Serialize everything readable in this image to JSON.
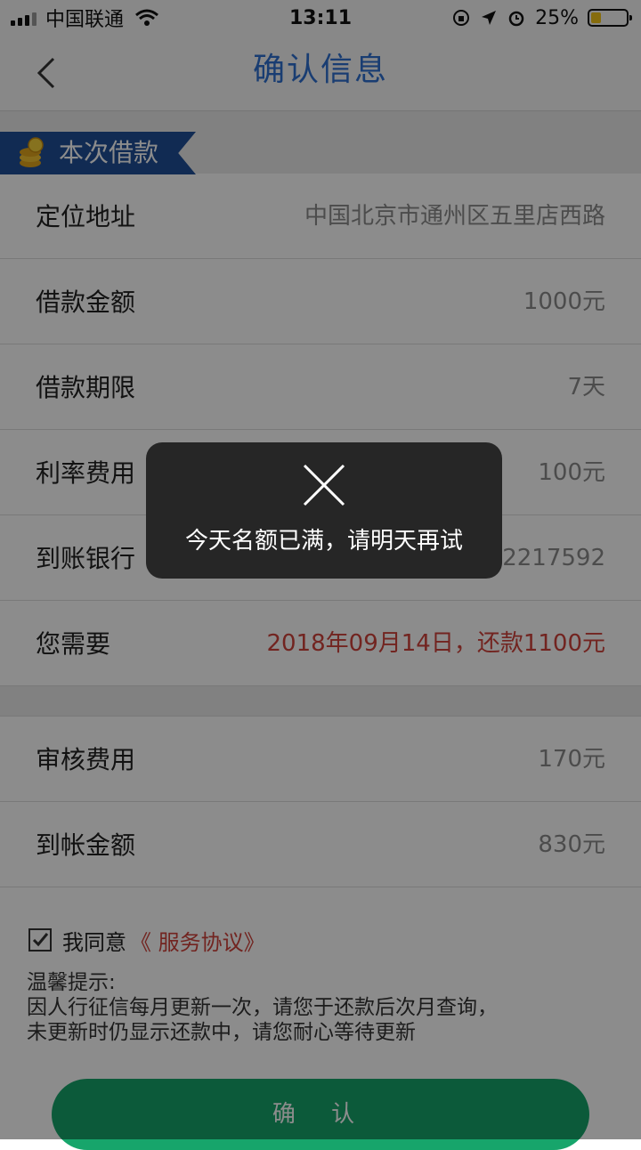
{
  "status_bar": {
    "carrier": "中国联通",
    "time": "13:11",
    "battery_percent": "25%",
    "battery_level": 0.25
  },
  "nav": {
    "title": "确认信息"
  },
  "section": {
    "title": "本次借款"
  },
  "rows": [
    {
      "label": "定位地址",
      "value": "中国北京市通州区五里店西路"
    },
    {
      "label": "借款金额",
      "value": "1000元"
    },
    {
      "label": "借款期限",
      "value": "7天"
    },
    {
      "label": "利率费用",
      "value": "100元"
    },
    {
      "label": "到账银行",
      "value": "52217592"
    },
    {
      "label": "您需要",
      "value": "2018年09月14日，还款1100元"
    }
  ],
  "fees": [
    {
      "label": "审核费用",
      "value": "170元"
    },
    {
      "label": "到帐金额",
      "value": "830元"
    }
  ],
  "agreement": {
    "text": "我同意",
    "link": "《 服务协议》",
    "checked": true
  },
  "tips": {
    "title": "温馨提示:",
    "line1": "因人行征信每月更新一次，请您于还款后次月查询，",
    "line2": "未更新时仍显示还款中，请您耐心等待更新"
  },
  "confirm_label": "确 认",
  "toast": {
    "message": "今天名额已满，请明天再试"
  },
  "colors": {
    "accent_blue": "#2f6fd0",
    "ribbon_blue": "#1f4f97",
    "alert_red": "#d0433b",
    "confirm_green": "#17a56b",
    "toast_bg": "#262626"
  }
}
